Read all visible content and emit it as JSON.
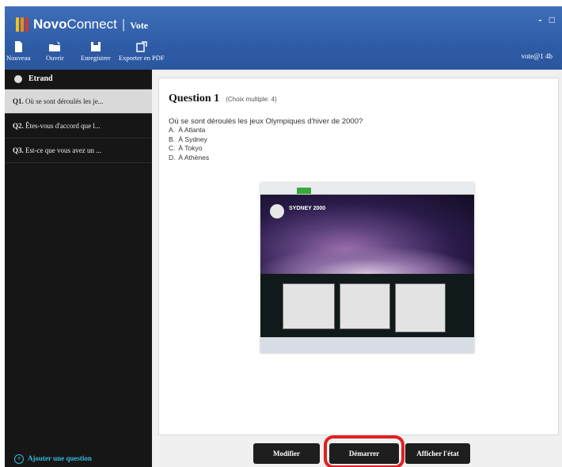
{
  "app": {
    "name_bold": "Novo",
    "name_rest": "Connect",
    "mode": "Vote",
    "window_controls": "- □"
  },
  "toolbar": {
    "items": [
      {
        "label": "Nouveau",
        "icon": "new-file-icon"
      },
      {
        "label": "Ouvrir",
        "icon": "open-folder-icon"
      },
      {
        "label": "Enregistrer",
        "icon": "save-disk-icon"
      },
      {
        "label": "Exporter en PDF",
        "icon": "export-icon"
      }
    ]
  },
  "user": {
    "name": "vote@1 4b"
  },
  "sidebar": {
    "header": "Etrand",
    "questions": [
      {
        "num": "Q1.",
        "text": "Où se sont déroulés les je..."
      },
      {
        "num": "Q2.",
        "text": "Êtes-vous d'accord que l..."
      },
      {
        "num": "Q3.",
        "text": "Est-ce que vous avez un ..."
      }
    ],
    "add_question": "Ajouter une question"
  },
  "question": {
    "title": "Question 1",
    "type": "(Choix multiple: 4)",
    "text": "Où se sont déroulés les jeux Olympiques d'hiver de 2000?",
    "options": [
      {
        "letter": "A.",
        "text": "À Atlanta"
      },
      {
        "letter": "B.",
        "text": "À Sydney"
      },
      {
        "letter": "C.",
        "text": "À Tokyo"
      },
      {
        "letter": "D.",
        "text": "À Athènes"
      }
    ],
    "image_site_name": "SYDNEY 2000"
  },
  "buttons": {
    "modify": "Modifier",
    "start": "Démarrer",
    "show_result": "Afficher l'état"
  },
  "colors": {
    "accent": "#2f5ca6",
    "highlight": "#e02020",
    "link": "#35b8d8"
  }
}
